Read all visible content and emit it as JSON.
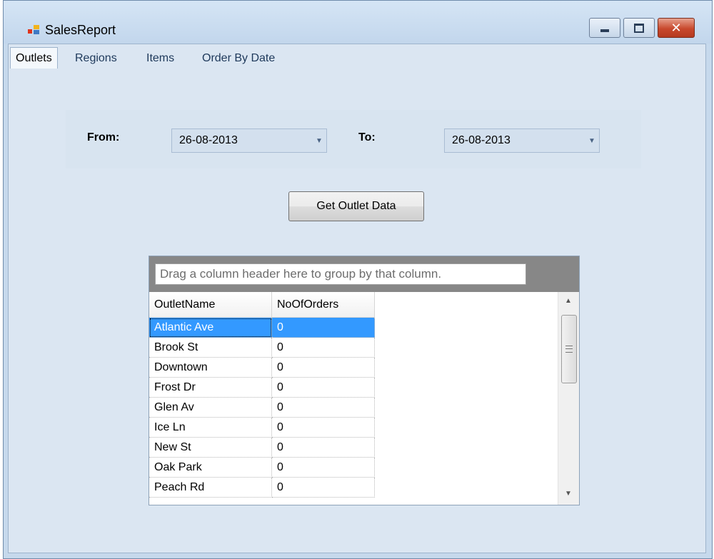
{
  "window": {
    "title": "SalesReport",
    "close_glyph": "✕",
    "icon": "app-icon"
  },
  "tabs": [
    {
      "label": "Outlets",
      "active": true
    },
    {
      "label": "Regions",
      "active": false
    },
    {
      "label": "Items",
      "active": false
    },
    {
      "label": "Order By Date",
      "active": false
    }
  ],
  "filter": {
    "from_label": "From:",
    "from_value": "26-08-2013",
    "to_label": "To:",
    "to_value": "26-08-2013"
  },
  "actions": {
    "get_label": "Get Outlet Data"
  },
  "grid": {
    "group_hint": "Drag a column header here to group by that column.",
    "columns": [
      "OutletName",
      "NoOfOrders"
    ],
    "rows": [
      [
        "Atlantic Ave",
        "0"
      ],
      [
        "Brook St",
        "0"
      ],
      [
        "Downtown",
        "0"
      ],
      [
        "Frost Dr",
        "0"
      ],
      [
        "Glen Av",
        "0"
      ],
      [
        "Ice Ln",
        "0"
      ],
      [
        "New St",
        "0"
      ],
      [
        "Oak Park",
        "0"
      ],
      [
        "Peach Rd",
        "0"
      ]
    ],
    "selected_row": 0,
    "scroll_up_glyph": "▲",
    "scroll_down_glyph": "▼",
    "combo_arrow_glyph": "▼"
  }
}
